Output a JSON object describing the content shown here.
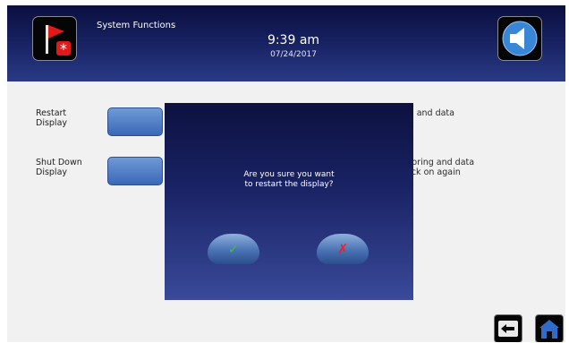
{
  "header": {
    "title": "System Functions",
    "time": "9:39 am",
    "date": "07/24/2017",
    "alert_icon": "red-flag-with-asterisk",
    "sound_icon": "speaker-icon"
  },
  "rows": [
    {
      "label_line1": "Restart",
      "label_line2": "Display",
      "desc_line1": "ig and data",
      "desc_line2": ""
    },
    {
      "label_line1": "Shut Down",
      "label_line2": "Display",
      "desc_line1": "itoring and data",
      "desc_line2": "ack on again"
    }
  ],
  "dialog": {
    "message_line1": "Are you sure you want",
    "message_line2": "to restart the display?",
    "confirm_glyph": "✓",
    "cancel_glyph": "✗"
  },
  "nav": {
    "back_icon": "back-arrow-icon",
    "home_icon": "home-icon"
  },
  "colors": {
    "header_top": "#0b0f3e",
    "header_bottom": "#2a3a86",
    "button_blue": "#4d7cc6",
    "confirm_green": "#3fbf3f",
    "cancel_red": "#e8242a"
  }
}
